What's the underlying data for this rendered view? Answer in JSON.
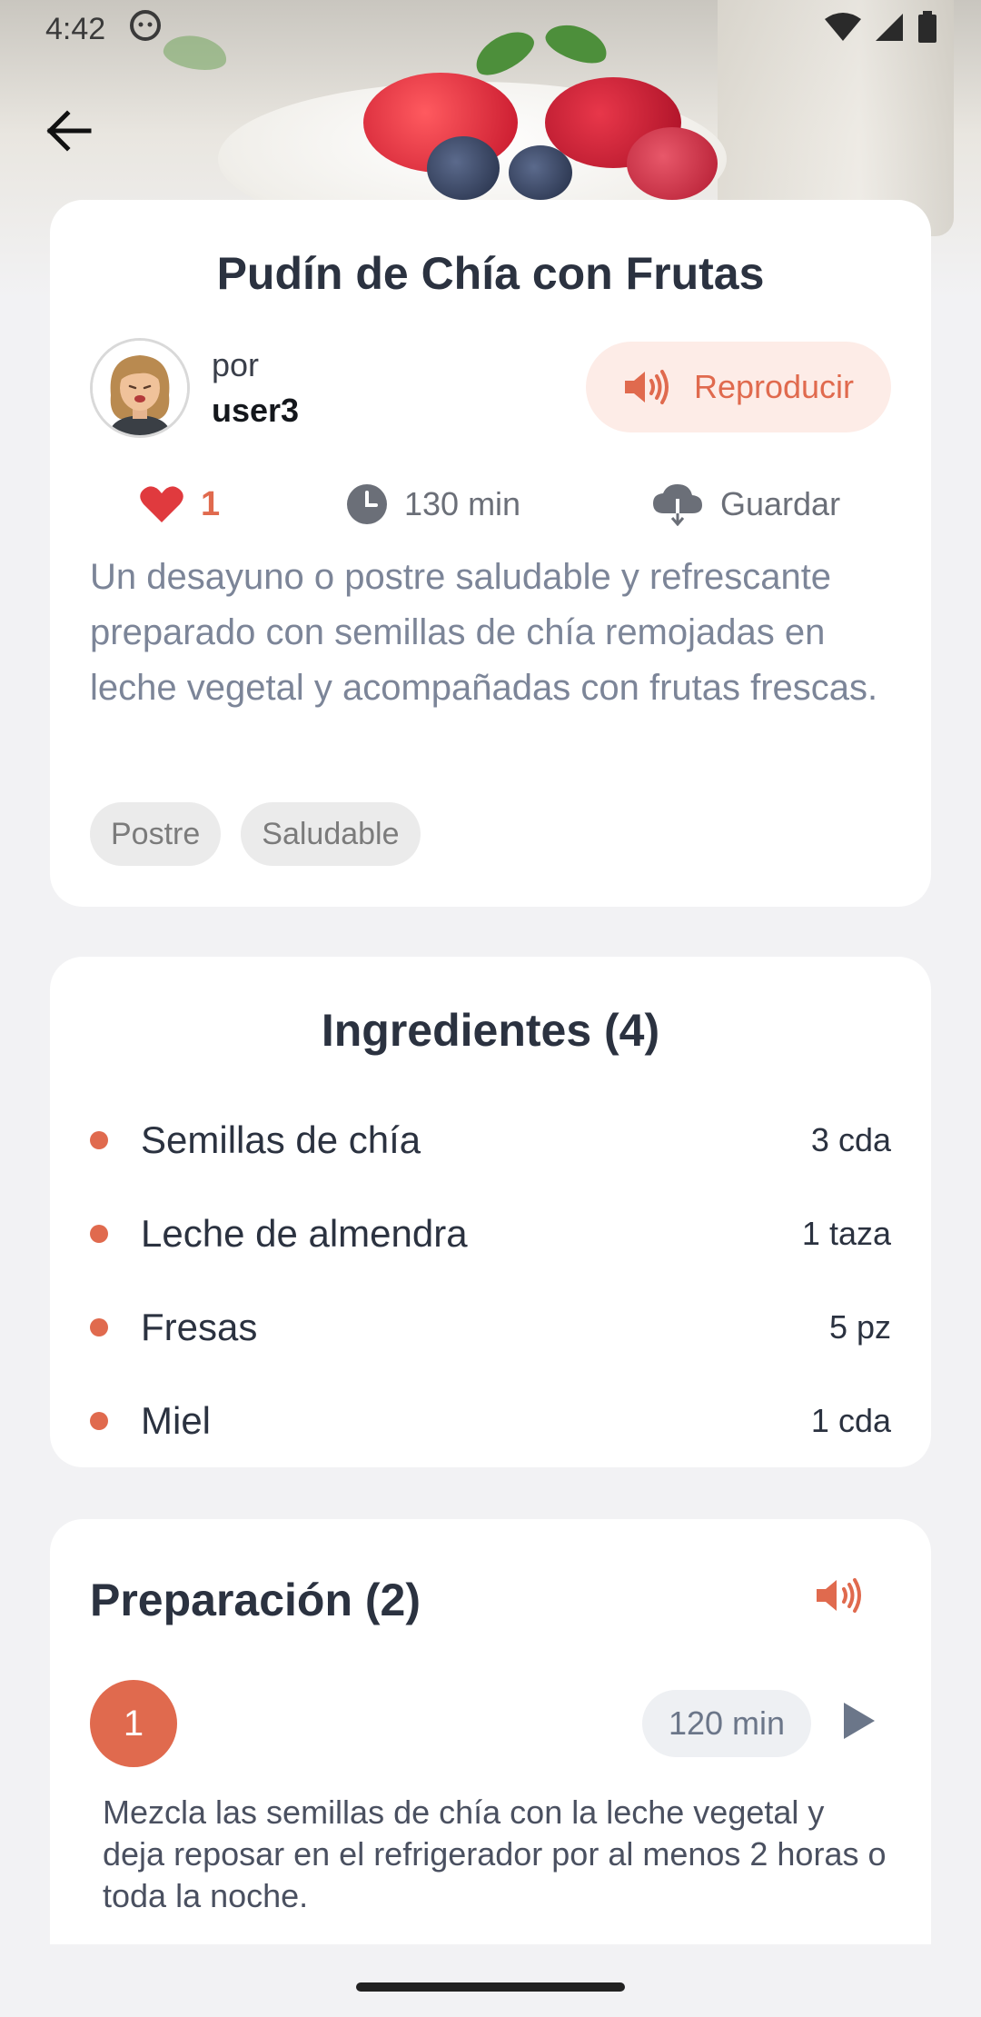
{
  "status_bar": {
    "time": "4:42",
    "notification_icon": "android-face-icon",
    "icons": [
      "wifi-icon",
      "signal-icon",
      "battery-icon"
    ]
  },
  "header": {
    "back_icon": "arrow-left-icon"
  },
  "recipe": {
    "title": "Pudín de Chía con Frutas",
    "author_prefix": "por",
    "author_name": "user3",
    "play_label": "Reproducir",
    "likes": "1",
    "time": "130 min",
    "save_label": "Guardar",
    "description": "Un desayuno o postre saludable y refrescante preparado con semillas de chía remojadas en leche vegetal y acompañadas con frutas frescas.",
    "tags": [
      "Postre",
      "Saludable"
    ]
  },
  "ingredients": {
    "title": "Ingredientes (4)",
    "items": [
      {
        "name": "Semillas de chía",
        "qty": "3 cda"
      },
      {
        "name": "Leche de almendra",
        "qty": "1 taza"
      },
      {
        "name": "Fresas",
        "qty": "5 pz"
      },
      {
        "name": "Miel",
        "qty": "1 cda"
      }
    ]
  },
  "preparation": {
    "title": "Preparación (2)",
    "steps": [
      {
        "number": "1",
        "time": "120 min",
        "text": "Mezcla las semillas de chía con la leche vegetal y deja reposar en el refrigerador por al menos 2 horas o toda la noche."
      }
    ]
  },
  "colors": {
    "accent": "#e06a4e",
    "title": "#2b3240",
    "muted": "#7c8598"
  }
}
